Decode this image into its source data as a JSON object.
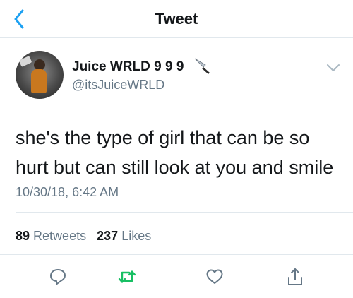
{
  "header": {
    "title": "Tweet"
  },
  "tweet": {
    "display_name": "Juice WRLD 9 9 9",
    "handle": "@itsJuiceWRLD",
    "text": "she's the type of girl that can be so hurt but can still look at you and smile",
    "timestamp": "10/30/18, 6:42 AM",
    "retweets": {
      "count": "89",
      "label": "Retweets"
    },
    "likes": {
      "count": "237",
      "label": "Likes"
    }
  },
  "colors": {
    "accent": "#1da1f2",
    "retweet_green": "#17bf63",
    "secondary_text": "#657786",
    "primary_text": "#14171a",
    "divider": "#e1e8ed"
  },
  "icons": {
    "back": "chevron-left-icon",
    "name_emoji": "knife-icon",
    "menu": "chevron-down-icon",
    "reply": "reply-icon",
    "retweet": "retweet-icon",
    "like": "heart-icon",
    "share": "share-icon"
  }
}
